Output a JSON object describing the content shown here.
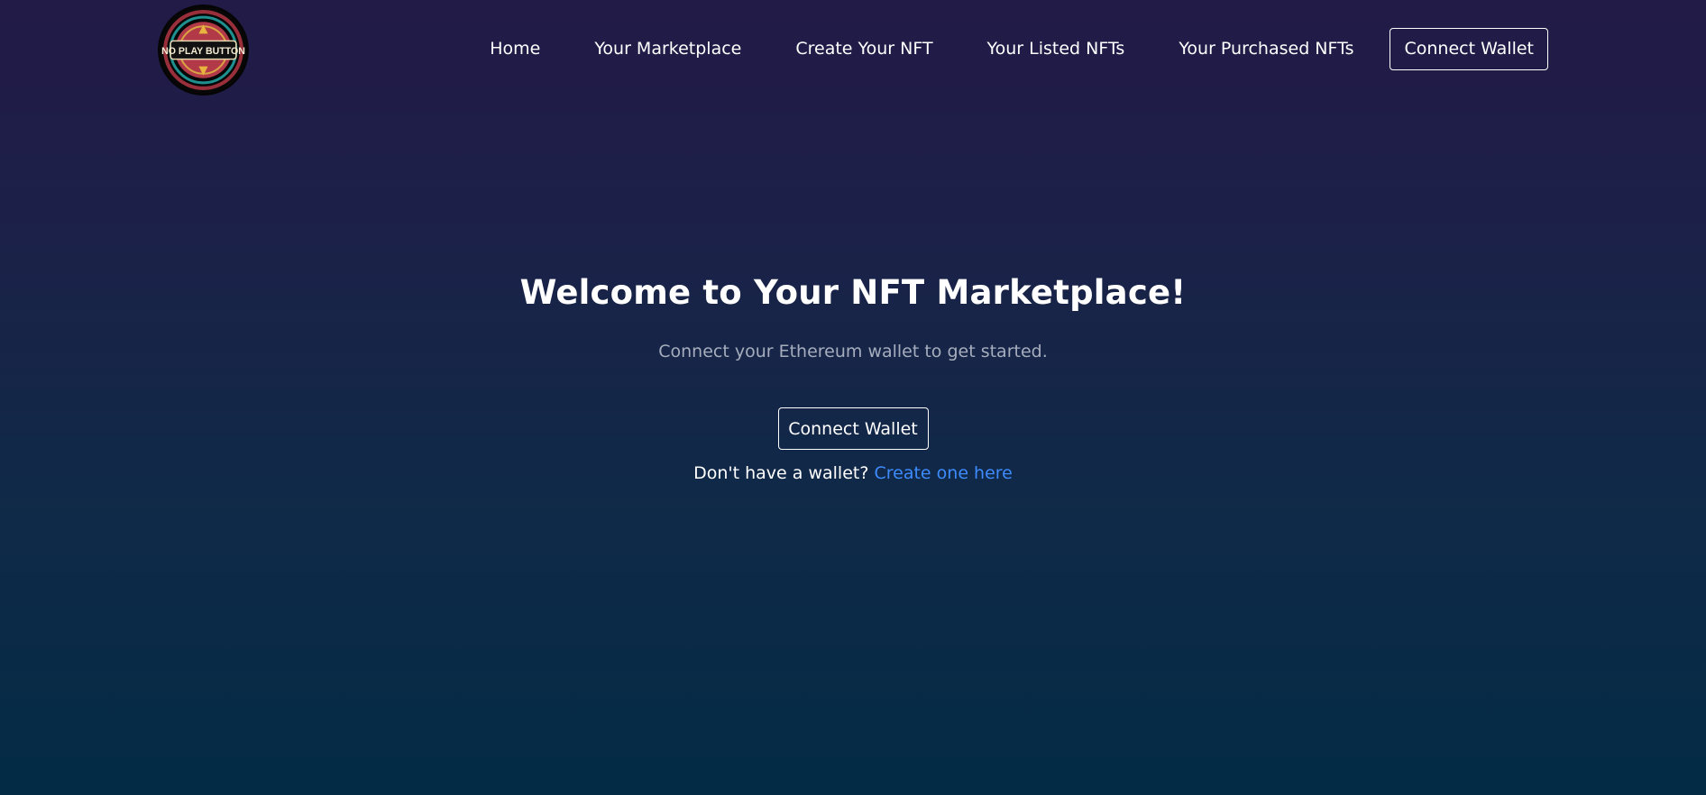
{
  "navbar": {
    "logo_text": "NO PLAY BUTTON",
    "links": [
      {
        "label": "Home"
      },
      {
        "label": "Your Marketplace"
      },
      {
        "label": "Create Your NFT"
      },
      {
        "label": "Your Listed NFTs"
      },
      {
        "label": "Your Purchased NFTs"
      }
    ],
    "connect_label": "Connect Wallet"
  },
  "hero": {
    "title": "Welcome to Your NFT Marketplace!",
    "subtitle": "Connect your Ethereum wallet to get started.",
    "connect_label": "Connect Wallet",
    "wallet_prompt": "Don't have a wallet?",
    "create_link": "Create one here"
  },
  "colors": {
    "background_top": "#221a47",
    "background_bottom": "#032b45",
    "subtitle_text": "#a6adbd",
    "link": "#3d8bfd",
    "border": "#ffffff"
  },
  "icons": {
    "logo": "no-play-button-logo-icon"
  }
}
